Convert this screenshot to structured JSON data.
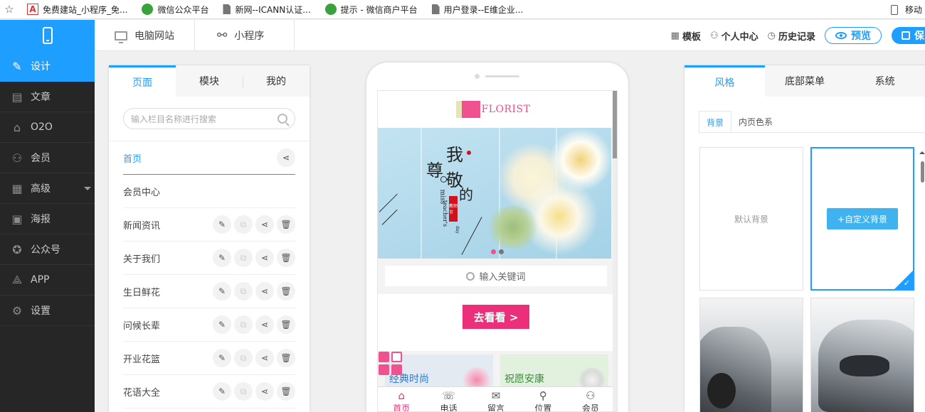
{
  "bookmarks": [
    {
      "label": "免费建站_小程序_免...",
      "icon": "pdf-icon"
    },
    {
      "label": "微信公众平台",
      "icon": "wechat-icon"
    },
    {
      "label": "新网--ICANN认证...",
      "icon": "document-icon"
    },
    {
      "label": "提示 - 微信商户平台",
      "icon": "wechat-icon"
    },
    {
      "label": "用户登录--E维企业...",
      "icon": "document-icon"
    }
  ],
  "bookmark_right": "移动",
  "topbar": {
    "tabs": [
      {
        "label": "电脑网站",
        "icon": "monitor-icon"
      },
      {
        "label": "小程序",
        "icon": "link-icon"
      }
    ],
    "actions": [
      {
        "label": "模板",
        "icon": "template-icon"
      },
      {
        "label": "个人中心",
        "icon": "user-icon"
      },
      {
        "label": "历史记录",
        "icon": "clock-icon"
      }
    ],
    "preview_label": "预览",
    "save_label": "保"
  },
  "leftnav": [
    {
      "label": "设计",
      "icon": "design-icon",
      "active": true
    },
    {
      "label": "文章",
      "icon": "article-icon"
    },
    {
      "label": "O2O",
      "icon": "store-icon"
    },
    {
      "label": "会员",
      "icon": "member-icon"
    },
    {
      "label": "高级",
      "icon": "grid-icon",
      "has_caret": true
    },
    {
      "label": "海报",
      "icon": "poster-icon"
    },
    {
      "label": "公众号",
      "icon": "badge-icon"
    },
    {
      "label": "APP",
      "icon": "app-icon"
    },
    {
      "label": "设置",
      "icon": "settings-icon"
    }
  ],
  "pages_panel": {
    "tabs": [
      "页面",
      "模块",
      "我的"
    ],
    "active_tab": "页面",
    "search_placeholder": "输入栏目名称进行搜索",
    "pages": [
      {
        "name": "首页",
        "active": true,
        "actions": [
          "share"
        ]
      },
      {
        "name": "会员中心",
        "actions": []
      },
      {
        "name": "新闻资讯",
        "actions": [
          "edit",
          "copy",
          "share",
          "delete"
        ]
      },
      {
        "name": "关于我们",
        "actions": [
          "edit",
          "copy",
          "share",
          "delete"
        ]
      },
      {
        "name": "生日鲜花",
        "actions": [
          "edit",
          "copy",
          "share",
          "delete"
        ]
      },
      {
        "name": "问候长辈",
        "actions": [
          "edit",
          "copy",
          "share",
          "delete"
        ]
      },
      {
        "name": "开业花篮",
        "actions": [
          "edit",
          "copy",
          "share",
          "delete"
        ]
      },
      {
        "name": "花语大全",
        "actions": [
          "edit",
          "copy",
          "share",
          "delete"
        ]
      }
    ]
  },
  "phone": {
    "brand": "FLORIST",
    "banner": {
      "char1": "我",
      "char2": "尊",
      "char3": "敬",
      "char4": "的",
      "sub1": "miss",
      "sub2": "teacher's",
      "sub3": "day",
      "stamp": "教师节",
      "slide_count": 2,
      "active_slide": 1
    },
    "search_placeholder": "输入关键词",
    "cta_label": "去看看 >",
    "cards": [
      {
        "label": "经典时尚",
        "color": "#2b7bd1"
      },
      {
        "label": "祝愿安康",
        "color": "#3a8b3a"
      }
    ],
    "tabbar": [
      {
        "label": "首页",
        "icon": "home-icon",
        "active": true
      },
      {
        "label": "电话",
        "icon": "phone-icon"
      },
      {
        "label": "留言",
        "icon": "message-icon"
      },
      {
        "label": "位置",
        "icon": "location-icon"
      },
      {
        "label": "会员",
        "icon": "member-icon"
      }
    ]
  },
  "style_panel": {
    "tabs": [
      "风格",
      "底部菜单",
      "系统"
    ],
    "active_tab": "风格",
    "subtabs": [
      "背景",
      "内页色系"
    ],
    "active_subtab": "背景",
    "default_bg_label": "默认背景",
    "custom_bg_label": "+自定义背景"
  },
  "colors": {
    "accent": "#1e9fff",
    "pink": "#ec2f7a",
    "nav_bg": "#262626"
  }
}
